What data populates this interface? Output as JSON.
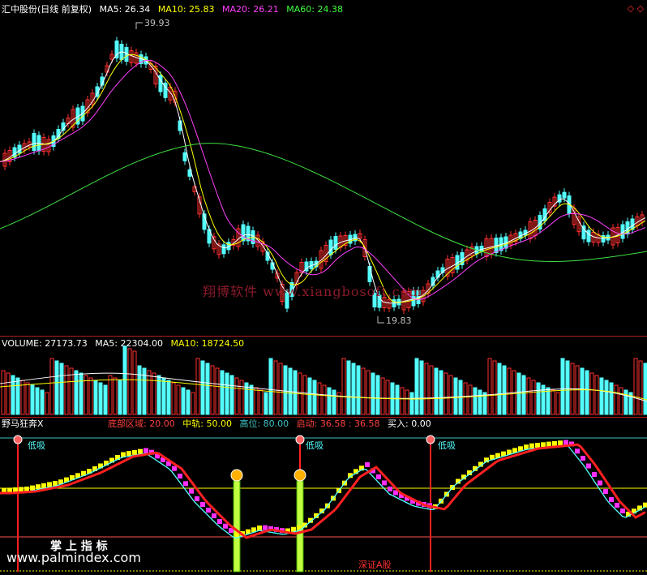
{
  "main": {
    "title": "汇中股份(日线 前复权)",
    "ma": [
      {
        "label": "MA5: 26.34",
        "color": "#ffffff"
      },
      {
        "label": "MA10: 25.83",
        "color": "#ffff00"
      },
      {
        "label": "MA20: 26.21",
        "color": "#ff40ff"
      },
      {
        "label": "MA60: 24.38",
        "color": "#40ff40"
      }
    ],
    "high_label": "39.93",
    "low_label": "19.83",
    "watermark": "翔博软件 www.xiangbosoft.com",
    "corner_icons": "◇ ◇"
  },
  "volume": {
    "labels": [
      {
        "label": "VOLUME: 27173.73",
        "color": "#ffffff"
      },
      {
        "label": "MA5: 22304.00",
        "color": "#ffffff"
      },
      {
        "label": "MA10: 18724.50",
        "color": "#ffff00"
      }
    ]
  },
  "indicator": {
    "name": "野马狂奔X",
    "params": [
      {
        "label": "底部区域: 20.00",
        "color": "#ff4040"
      },
      {
        "label": "中轨: 50.00",
        "color": "#ffff00"
      },
      {
        "label": "高位: 80.00",
        "color": "#40c0c0"
      },
      {
        "label": "启动: 36.58 : 36.58",
        "color": "#ff4040"
      },
      {
        "label": "买入: 0.00",
        "color": "#ffffff"
      }
    ],
    "signal_label": "低吸",
    "footer_text": "掌 上 指 标",
    "footer_url": "www.palmindex.com",
    "index_label": "深证A股"
  },
  "colors": {
    "up": "#ff3030",
    "down": "#54ffff",
    "grid": "#b02020"
  }
}
